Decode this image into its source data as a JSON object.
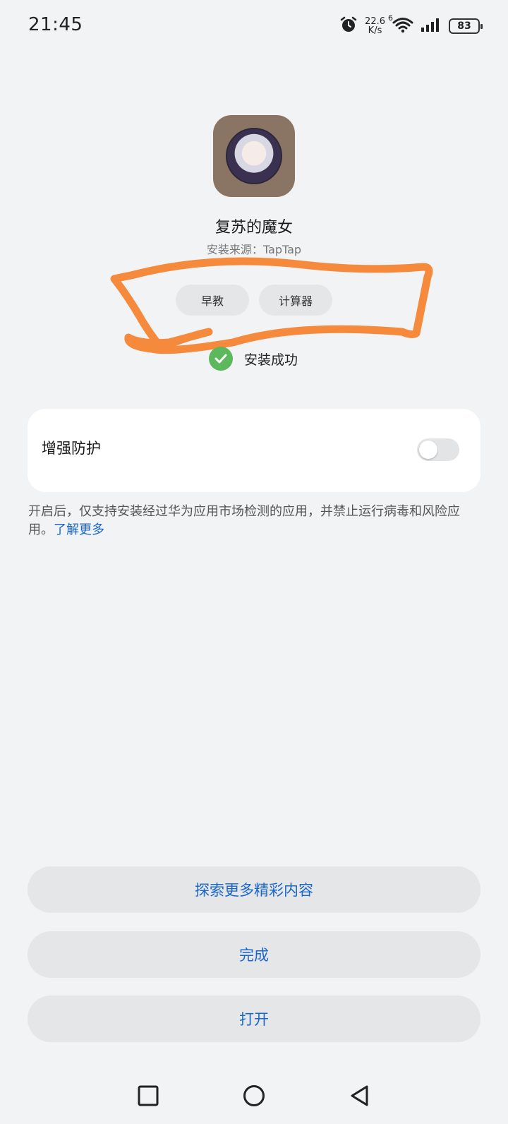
{
  "status_bar": {
    "time": "21:45",
    "net_speed_value": "22.6",
    "net_speed_unit": "K/s",
    "signal_gen": "6",
    "battery": "83",
    "icons": [
      "alarm-icon",
      "wifi-icon",
      "cellular-signal-icon",
      "battery-icon"
    ]
  },
  "app": {
    "icon": "app-icon",
    "name": "复苏的魔女",
    "source": "安装来源：TapTap",
    "tags": [
      "早教",
      "计算器"
    ]
  },
  "install_status": {
    "text": "安装成功",
    "icon": "check-circle-icon",
    "color": "#5cb85c"
  },
  "protection": {
    "label": "增强防护",
    "enabled": false,
    "description": "开启后，仅支持安装经过华为应用市场检测的应用，并禁止运行病毒和风险应用。",
    "learn_more": "了解更多"
  },
  "buttons": {
    "explore": "探索更多精彩内容",
    "done": "完成",
    "open": "打开"
  },
  "nav": {
    "icons": [
      "recent-apps-icon",
      "home-icon",
      "back-icon"
    ]
  },
  "colors": {
    "accent": "#1a66c9",
    "annotation": "#f58a3c",
    "background": "#f1f3f5"
  }
}
